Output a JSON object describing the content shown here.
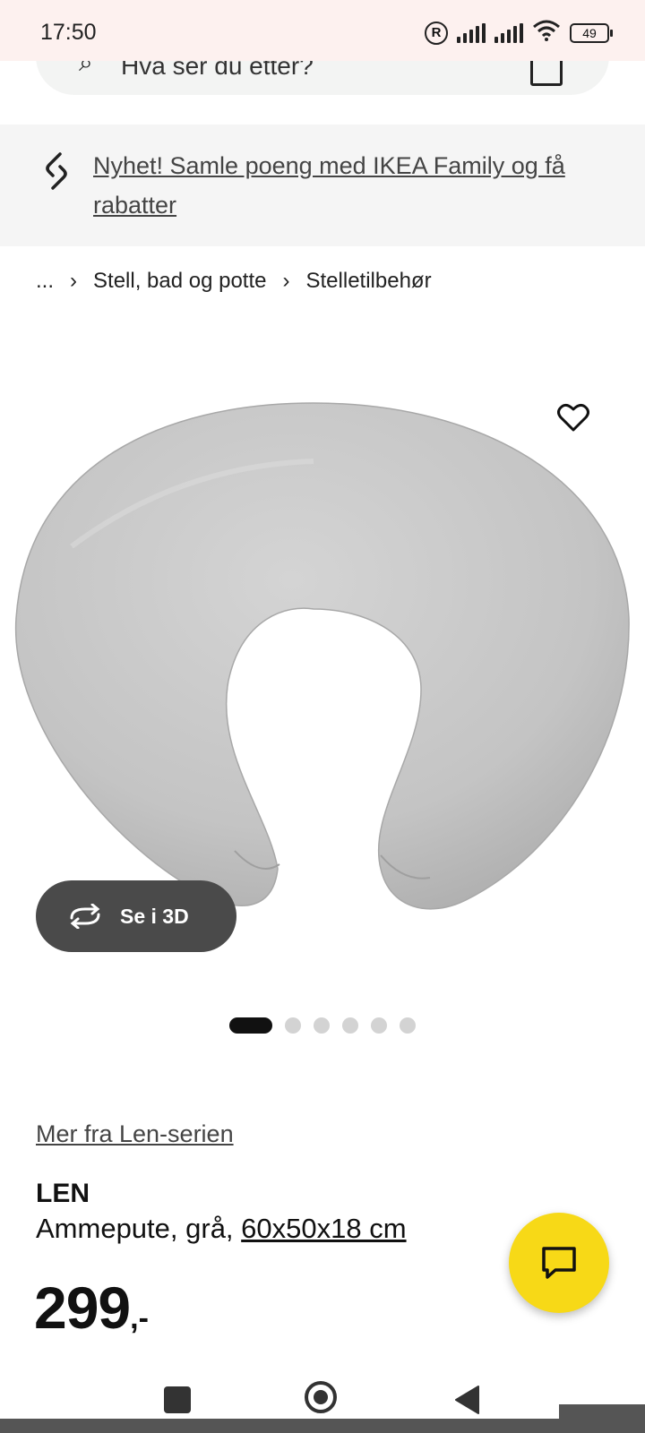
{
  "status_bar": {
    "time": "17:50",
    "battery": "49",
    "icons": [
      "registered-icon",
      "signal-icon",
      "signal-icon",
      "wifi-icon",
      "battery-icon"
    ]
  },
  "search": {
    "placeholder": "Hva ser du etter?"
  },
  "promo": {
    "text": "Nyhet! Samle poeng med IKEA Family og få rabatter",
    "icon": "link-chain-icon"
  },
  "breadcrumb": {
    "ellipsis": "...",
    "items": [
      "Stell, bad og potte",
      "Stelletilbehør"
    ],
    "separator": "›"
  },
  "gallery": {
    "image": "nursing-pillow-image",
    "image_color": "#c8c8c8",
    "view_3d_label": "Se i 3D",
    "slide_count": 6,
    "active_slide": 1
  },
  "product": {
    "series_link": "Mer fra Len-serien",
    "name": "LEN",
    "description": "Ammepute, grå,",
    "size": "60x50x18 cm",
    "price": "299",
    "price_suffix": ",-"
  },
  "chat": {
    "icon": "chat-icon",
    "color": "#f7d917"
  },
  "nav": {
    "icons": [
      "recents-icon",
      "home-icon",
      "back-icon"
    ]
  }
}
